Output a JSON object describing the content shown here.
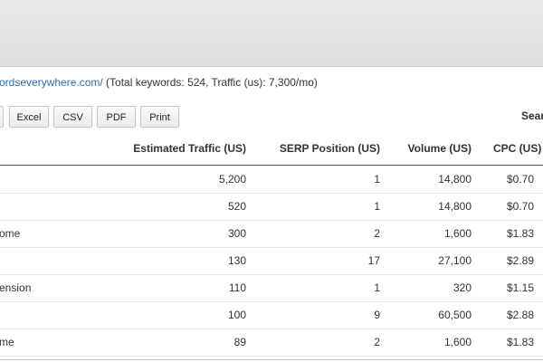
{
  "subtitle": {
    "link_text": "ordseverywhere.com/",
    "summary": " (Total keywords: 524, Traffic (us): 7,300/mo)"
  },
  "toolbar": {
    "buttons": [
      "",
      "Excel",
      "CSV",
      "PDF",
      "Print"
    ],
    "search_label": "Sear"
  },
  "table": {
    "headers": [
      "Estimated Traffic (US)",
      "SERP Position (US)",
      "Volume (US)",
      "CPC (US)"
    ],
    "rows": [
      {
        "keyword": "",
        "traffic": "5,200",
        "position": "1",
        "volume": "14,800",
        "cpc": "$0.70"
      },
      {
        "keyword": "",
        "traffic": "520",
        "position": "1",
        "volume": "14,800",
        "cpc": "$0.70"
      },
      {
        "keyword": "ome",
        "traffic": "300",
        "position": "2",
        "volume": "1,600",
        "cpc": "$1.83"
      },
      {
        "keyword": "",
        "traffic": "130",
        "position": "17",
        "volume": "27,100",
        "cpc": "$2.89"
      },
      {
        "keyword": "ension",
        "traffic": "110",
        "position": "1",
        "volume": "320",
        "cpc": "$1.15"
      },
      {
        "keyword": "",
        "traffic": "100",
        "position": "9",
        "volume": "60,500",
        "cpc": "$2.88"
      },
      {
        "keyword": "me",
        "traffic": "89",
        "position": "2",
        "volume": "1,600",
        "cpc": "$1.83"
      }
    ]
  }
}
